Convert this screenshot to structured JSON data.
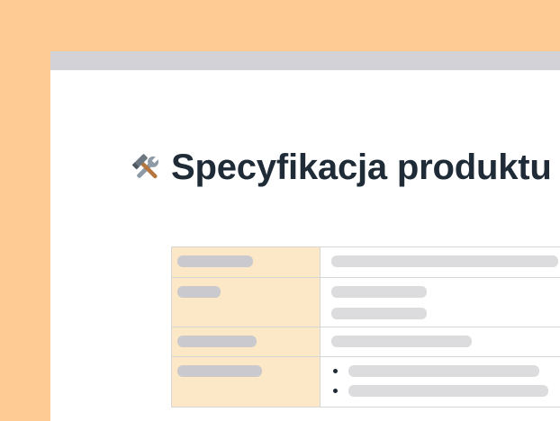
{
  "document": {
    "title": "Specyfikacja produktu",
    "title_icon": "hammer-and-wrench-icon"
  },
  "spec_table": {
    "rows": [
      {
        "key": "",
        "values": [
          ""
        ],
        "list": false
      },
      {
        "key": "",
        "values": [
          "",
          ""
        ],
        "list": false
      },
      {
        "key": "",
        "values": [
          ""
        ],
        "list": false
      },
      {
        "key": "",
        "values": [
          "",
          ""
        ],
        "list": true
      }
    ]
  },
  "colors": {
    "background": "#FFCB94",
    "titlebar": "#D3D2D6",
    "key_cell": "#FCE8C6",
    "heading_text": "#1F2B37"
  }
}
